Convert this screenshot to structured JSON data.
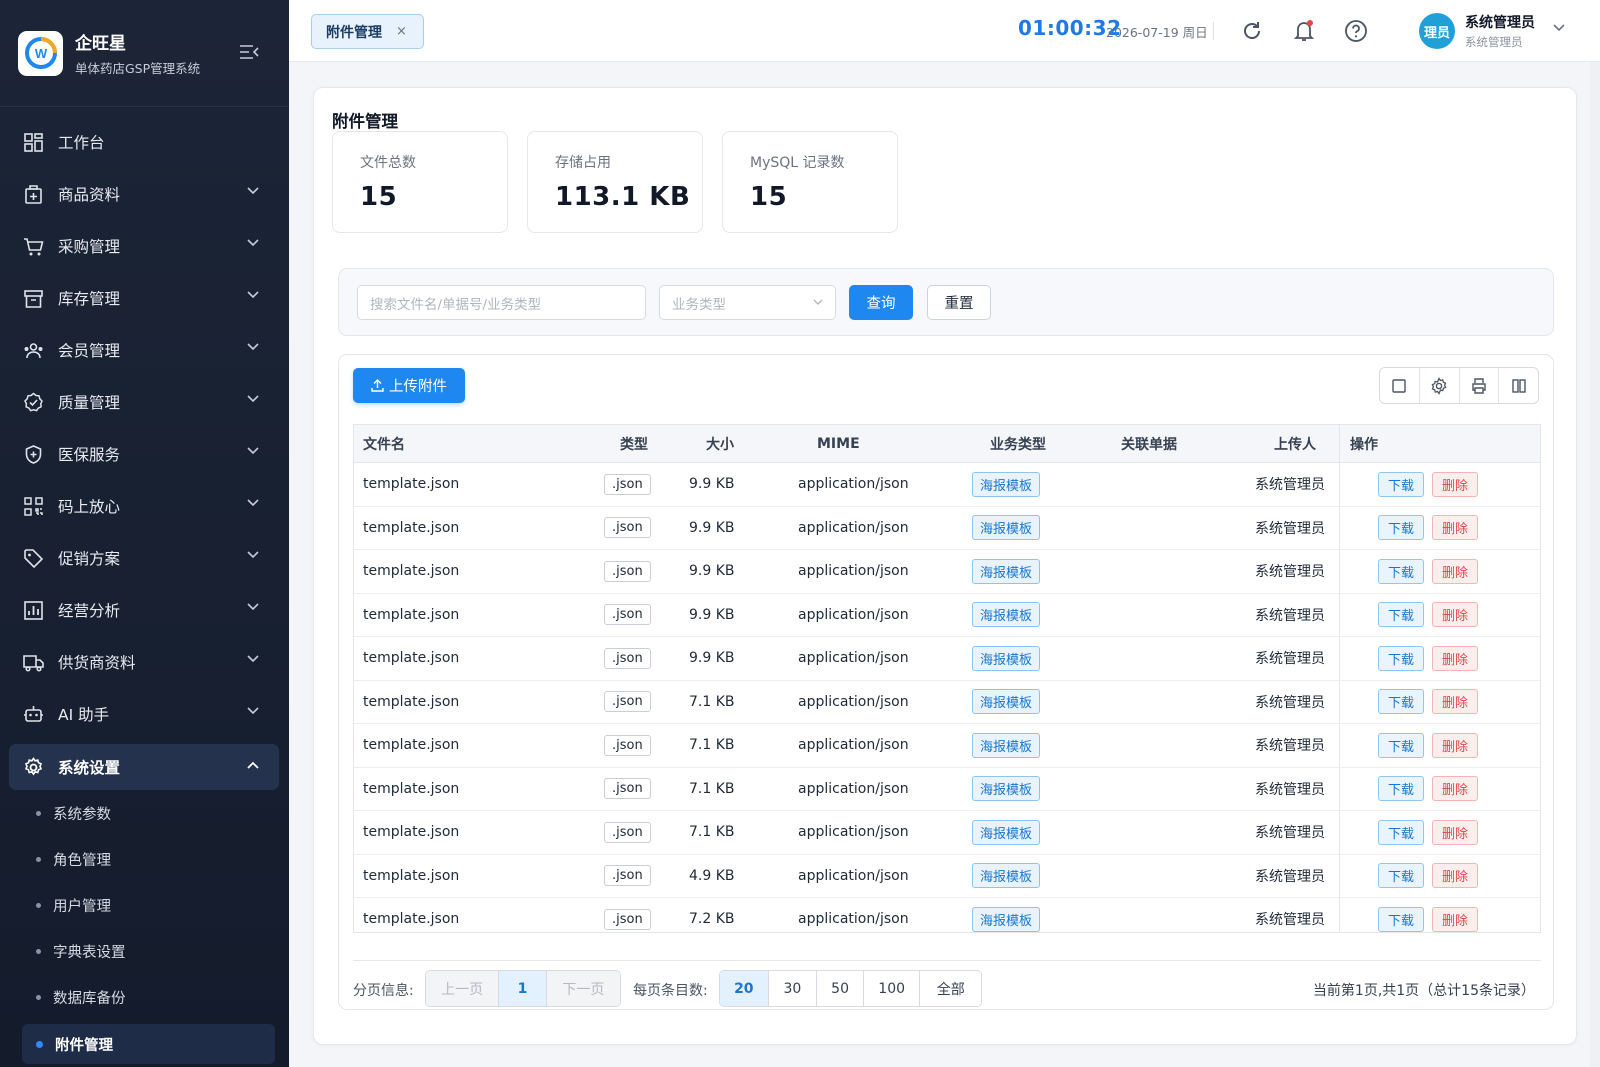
{
  "brand": {
    "name": "企旺星",
    "subtitle": "单体药店GSP管理系统",
    "logo_letter": "W"
  },
  "sidebar": {
    "items": [
      {
        "label": "工作台",
        "icon": "dashboard-icon",
        "expandable": false
      },
      {
        "label": "商品资料",
        "icon": "product-icon",
        "expandable": true
      },
      {
        "label": "采购管理",
        "icon": "cart-icon",
        "expandable": true
      },
      {
        "label": "库存管理",
        "icon": "inventory-icon",
        "expandable": true
      },
      {
        "label": "会员管理",
        "icon": "members-icon",
        "expandable": true
      },
      {
        "label": "质量管理",
        "icon": "quality-icon",
        "expandable": true
      },
      {
        "label": "医保服务",
        "icon": "shield-icon",
        "expandable": true
      },
      {
        "label": "码上放心",
        "icon": "qr-code-icon",
        "expandable": true
      },
      {
        "label": "促销方案",
        "icon": "tag-icon",
        "expandable": true
      },
      {
        "label": "经营分析",
        "icon": "chart-icon",
        "expandable": true
      },
      {
        "label": "供货商资料",
        "icon": "truck-icon",
        "expandable": true
      },
      {
        "label": "AI 助手",
        "icon": "robot-icon",
        "expandable": true
      },
      {
        "label": "系统设置",
        "icon": "gear-icon",
        "expandable": true,
        "active": true
      }
    ],
    "subitems": [
      "系统参数",
      "角色管理",
      "用户管理",
      "字典表设置",
      "数据库备份",
      "附件管理"
    ],
    "current_subitem": "附件管理"
  },
  "topbar": {
    "tab_label": "附件管理",
    "tab_close": "×",
    "clock": "01:00:32",
    "date": "2026-07-19 周日",
    "user_name": "系统管理员",
    "user_role": "系统管理员",
    "avatar_text": "理员"
  },
  "page": {
    "title": "附件管理",
    "stats": [
      {
        "label": "文件总数",
        "value": "15"
      },
      {
        "label": "存储占用",
        "value": "113.1 KB"
      },
      {
        "label": "MySQL 记录数",
        "value": "15"
      }
    ],
    "search": {
      "placeholder": "搜索文件名/单据号/业务类型"
    },
    "biz_select": {
      "placeholder": "业务类型"
    },
    "query_label": "查询",
    "reset_label": "重置",
    "upload_label": "上传附件"
  },
  "table": {
    "columns": [
      "文件名",
      "类型",
      "大小",
      "MIME",
      "业务类型",
      "关联单据",
      "上传人",
      "操作"
    ],
    "rows": [
      {
        "name": "template.json",
        "type": ".json",
        "size": "9.9 KB",
        "mime": "application/json",
        "biz": "海报模板",
        "ref": "",
        "uploader": "系统管理员"
      },
      {
        "name": "template.json",
        "type": ".json",
        "size": "9.9 KB",
        "mime": "application/json",
        "biz": "海报模板",
        "ref": "",
        "uploader": "系统管理员"
      },
      {
        "name": "template.json",
        "type": ".json",
        "size": "9.9 KB",
        "mime": "application/json",
        "biz": "海报模板",
        "ref": "",
        "uploader": "系统管理员"
      },
      {
        "name": "template.json",
        "type": ".json",
        "size": "9.9 KB",
        "mime": "application/json",
        "biz": "海报模板",
        "ref": "",
        "uploader": "系统管理员"
      },
      {
        "name": "template.json",
        "type": ".json",
        "size": "9.9 KB",
        "mime": "application/json",
        "biz": "海报模板",
        "ref": "",
        "uploader": "系统管理员"
      },
      {
        "name": "template.json",
        "type": ".json",
        "size": "7.1 KB",
        "mime": "application/json",
        "biz": "海报模板",
        "ref": "",
        "uploader": "系统管理员"
      },
      {
        "name": "template.json",
        "type": ".json",
        "size": "7.1 KB",
        "mime": "application/json",
        "biz": "海报模板",
        "ref": "",
        "uploader": "系统管理员"
      },
      {
        "name": "template.json",
        "type": ".json",
        "size": "7.1 KB",
        "mime": "application/json",
        "biz": "海报模板",
        "ref": "",
        "uploader": "系统管理员"
      },
      {
        "name": "template.json",
        "type": ".json",
        "size": "7.1 KB",
        "mime": "application/json",
        "biz": "海报模板",
        "ref": "",
        "uploader": "系统管理员"
      },
      {
        "name": "template.json",
        "type": ".json",
        "size": "4.9 KB",
        "mime": "application/json",
        "biz": "海报模板",
        "ref": "",
        "uploader": "系统管理员"
      },
      {
        "name": "template.json",
        "type": ".json",
        "size": "7.2 KB",
        "mime": "application/json",
        "biz": "海报模板",
        "ref": "",
        "uploader": "系统管理员"
      }
    ],
    "download_label": "下载",
    "delete_label": "删除"
  },
  "pager": {
    "info_label": "分页信息:",
    "prev": "上一页",
    "current": "1",
    "next": "下一页",
    "size_label": "每页条目数:",
    "sizes": [
      "20",
      "30",
      "50",
      "100",
      "全部"
    ],
    "selected_size": "20",
    "summary": "当前第1页,共1页（总计15条记录）"
  },
  "colors": {
    "accent": "#1e88f0",
    "sidebar_bg": "#1c2537",
    "danger": "#e04848"
  }
}
